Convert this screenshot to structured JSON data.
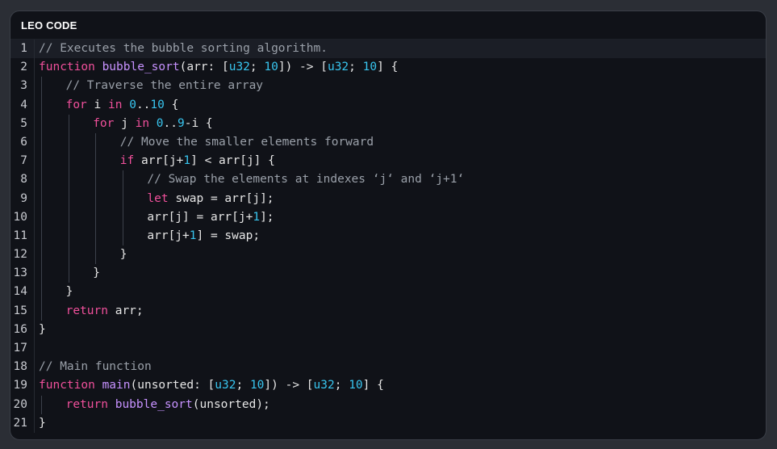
{
  "panel": {
    "title": "LEO CODE"
  },
  "colors": {
    "background": "#2b2e35",
    "panel": "#101218",
    "comment": "#9aa0a9",
    "keyword": "#f0509b",
    "function": "#c792ff",
    "type": "#38c5ef",
    "number": "#38c5ef",
    "text": "#e6e6e6"
  },
  "code_lines": [
    {
      "n": "1",
      "indent": 0,
      "tokens": [
        [
          "cmt",
          "// Executes the bubble sorting algorithm."
        ]
      ]
    },
    {
      "n": "2",
      "indent": 0,
      "tokens": [
        [
          "kw",
          "function"
        ],
        [
          "p",
          " "
        ],
        [
          "fn",
          "bubble_sort"
        ],
        [
          "p",
          "(arr: ["
        ],
        [
          "ty",
          "u32"
        ],
        [
          "p",
          "; "
        ],
        [
          "num",
          "10"
        ],
        [
          "p",
          "]) -> ["
        ],
        [
          "ty",
          "u32"
        ],
        [
          "p",
          "; "
        ],
        [
          "num",
          "10"
        ],
        [
          "p",
          "] {"
        ]
      ]
    },
    {
      "n": "3",
      "indent": 1,
      "tokens": [
        [
          "cmt",
          "// Traverse the entire array"
        ]
      ]
    },
    {
      "n": "4",
      "indent": 1,
      "tokens": [
        [
          "kw",
          "for"
        ],
        [
          "p",
          " i "
        ],
        [
          "kw",
          "in"
        ],
        [
          "p",
          " "
        ],
        [
          "num",
          "0"
        ],
        [
          "p",
          ".."
        ],
        [
          "num",
          "10"
        ],
        [
          "p",
          " {"
        ]
      ]
    },
    {
      "n": "5",
      "indent": 2,
      "tokens": [
        [
          "kw",
          "for"
        ],
        [
          "p",
          " j "
        ],
        [
          "kw",
          "in"
        ],
        [
          "p",
          " "
        ],
        [
          "num",
          "0"
        ],
        [
          "p",
          ".."
        ],
        [
          "num",
          "9"
        ],
        [
          "p",
          "-i {"
        ]
      ]
    },
    {
      "n": "6",
      "indent": 3,
      "tokens": [
        [
          "cmt",
          "// Move the smaller elements forward"
        ]
      ]
    },
    {
      "n": "7",
      "indent": 3,
      "tokens": [
        [
          "kw",
          "if"
        ],
        [
          "p",
          " arr[j+"
        ],
        [
          "num",
          "1"
        ],
        [
          "p",
          "] < arr[j] {"
        ]
      ]
    },
    {
      "n": "8",
      "indent": 4,
      "tokens": [
        [
          "cmt",
          "// Swap the elements at indexes ‘j‘ and ‘j+1‘"
        ]
      ]
    },
    {
      "n": "9",
      "indent": 4,
      "tokens": [
        [
          "kw",
          "let"
        ],
        [
          "p",
          " swap = arr[j];"
        ]
      ]
    },
    {
      "n": "10",
      "indent": 4,
      "tokens": [
        [
          "p",
          "arr[j] = arr[j+"
        ],
        [
          "num",
          "1"
        ],
        [
          "p",
          "];"
        ]
      ]
    },
    {
      "n": "11",
      "indent": 4,
      "tokens": [
        [
          "p",
          "arr[j+"
        ],
        [
          "num",
          "1"
        ],
        [
          "p",
          "] = swap;"
        ]
      ]
    },
    {
      "n": "12",
      "indent": 3,
      "tokens": [
        [
          "p",
          "}"
        ]
      ]
    },
    {
      "n": "13",
      "indent": 2,
      "tokens": [
        [
          "p",
          "}"
        ]
      ]
    },
    {
      "n": "14",
      "indent": 1,
      "tokens": [
        [
          "p",
          "}"
        ]
      ]
    },
    {
      "n": "15",
      "indent": 1,
      "tokens": [
        [
          "kw",
          "return"
        ],
        [
          "p",
          " arr;"
        ]
      ]
    },
    {
      "n": "16",
      "indent": 0,
      "tokens": [
        [
          "p",
          "}"
        ]
      ]
    },
    {
      "n": "17",
      "indent": 0,
      "tokens": []
    },
    {
      "n": "18",
      "indent": 0,
      "tokens": [
        [
          "cmt",
          "// Main function"
        ]
      ]
    },
    {
      "n": "19",
      "indent": 0,
      "tokens": [
        [
          "kw",
          "function"
        ],
        [
          "p",
          " "
        ],
        [
          "fn",
          "main"
        ],
        [
          "p",
          "(unsorted: ["
        ],
        [
          "ty",
          "u32"
        ],
        [
          "p",
          "; "
        ],
        [
          "num",
          "10"
        ],
        [
          "p",
          "]) -> ["
        ],
        [
          "ty",
          "u32"
        ],
        [
          "p",
          "; "
        ],
        [
          "num",
          "10"
        ],
        [
          "p",
          "] {"
        ]
      ]
    },
    {
      "n": "20",
      "indent": 1,
      "tokens": [
        [
          "kw",
          "return"
        ],
        [
          "p",
          " "
        ],
        [
          "fn",
          "bubble_sort"
        ],
        [
          "p",
          "(unsorted);"
        ]
      ]
    },
    {
      "n": "21",
      "indent": 0,
      "tokens": [
        [
          "p",
          "}"
        ]
      ]
    }
  ]
}
